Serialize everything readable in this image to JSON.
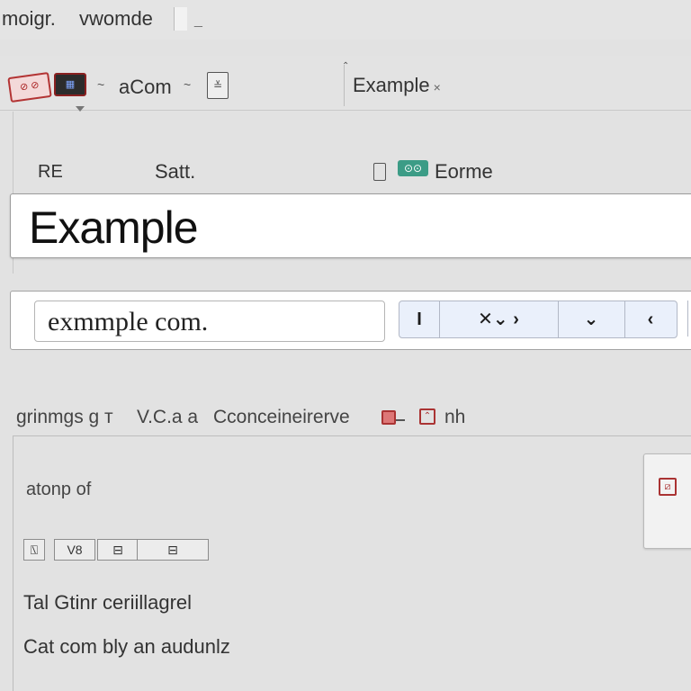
{
  "titlebar": {
    "left_text": "moigr.",
    "right_text": "vwomde",
    "trail": "_"
  },
  "tabstrip": {
    "icon_red_label": "⊘ ⊘",
    "icon_dark_label": "▦",
    "sep_left": "~",
    "tab_label": "aCom",
    "sep_right": "~",
    "doc_icon": "≚",
    "active_tab": "Example",
    "active_tab_close": "×"
  },
  "labels_row": {
    "left": "RE",
    "middle": "Satt.",
    "green_badge": "⊙⊙",
    "right": "Eorme"
  },
  "search": {
    "value": "Example"
  },
  "url_bar": {
    "value": "exmmple com.",
    "buttons": [
      "I",
      "✕⌄ ›",
      "⌄",
      "‹"
    ]
  },
  "section": {
    "items": [
      "grinmgs g т",
      "V.C.a a",
      "Cconceineirerve",
      "nh"
    ]
  },
  "panel": {
    "caption": "atonp of",
    "toolbar": [
      "⍂",
      "V8",
      "⊟",
      "⊟"
    ]
  },
  "lines": [
    "Tal  Gtinr  ceriillagrel",
    "Cat  com  bly an audunlz"
  ],
  "colors": {
    "accent_red": "#b33434",
    "accent_green": "#3c9c86",
    "button_bg": "#eaf0fb"
  }
}
